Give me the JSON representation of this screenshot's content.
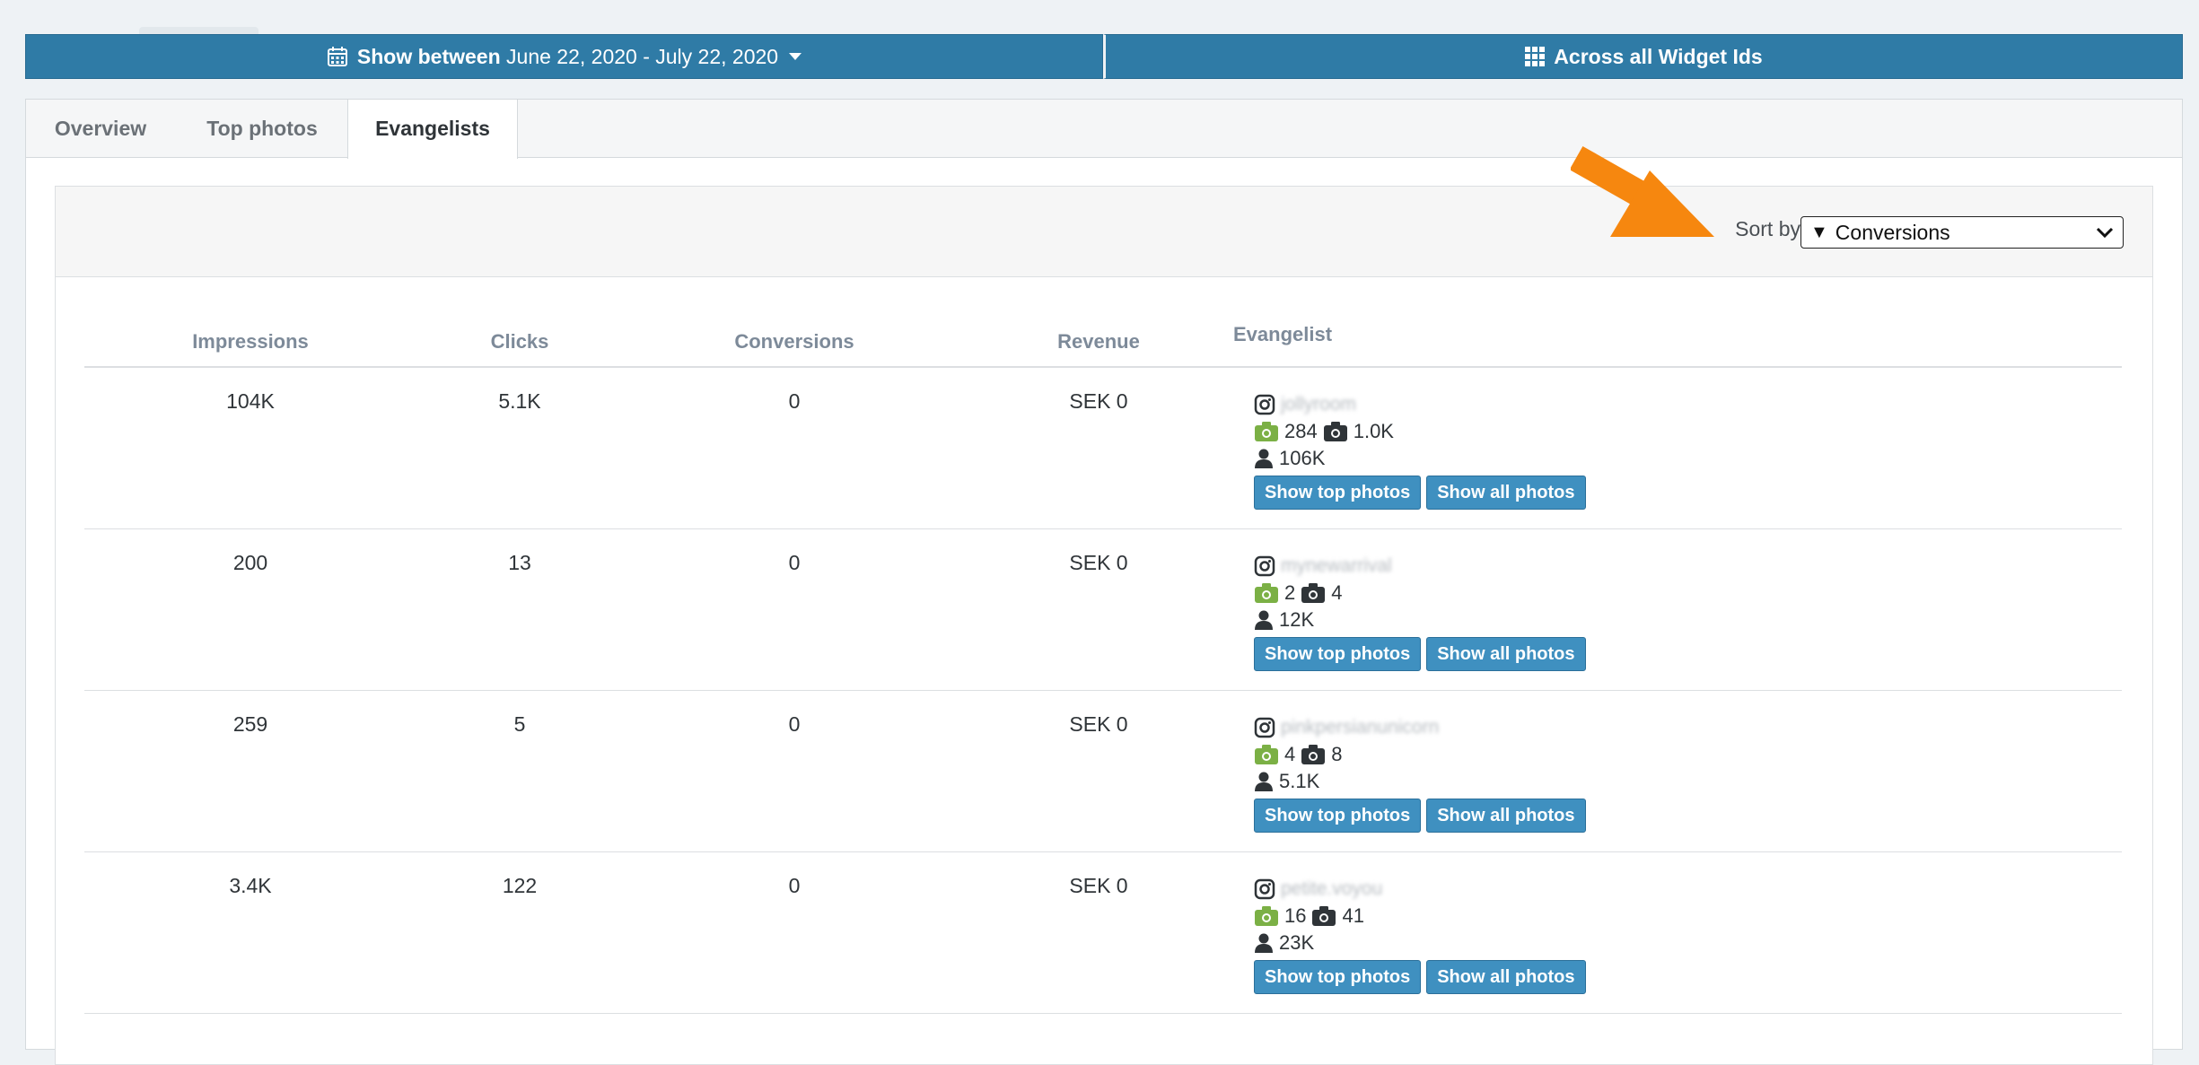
{
  "filter_bar": {
    "date_label": "Show between",
    "date_range": "June 22, 2020 - July 22, 2020",
    "widget_label": "Across all Widget Ids"
  },
  "tabs": [
    {
      "label": "Overview",
      "active": false
    },
    {
      "label": "Top photos",
      "active": false
    },
    {
      "label": "Evangelists",
      "active": true
    }
  ],
  "sort": {
    "label": "Sort by",
    "selected_marker": "▼",
    "selected": "Conversions"
  },
  "columns": {
    "impressions": "Impressions",
    "clicks": "Clicks",
    "conversions": "Conversions",
    "revenue": "Revenue",
    "evangelist": "Evangelist"
  },
  "buttons": {
    "show_top": "Show top photos",
    "show_all": "Show all photos"
  },
  "rows": [
    {
      "impressions": "104K",
      "clicks": "5.1K",
      "conversions": "0",
      "revenue": "SEK 0",
      "username": "jollyroom",
      "top_photos": "284",
      "all_photos": "1.0K",
      "followers": "106K"
    },
    {
      "impressions": "200",
      "clicks": "13",
      "conversions": "0",
      "revenue": "SEK 0",
      "username": "mynewarrival",
      "top_photos": "2",
      "all_photos": "4",
      "followers": "12K"
    },
    {
      "impressions": "259",
      "clicks": "5",
      "conversions": "0",
      "revenue": "SEK 0",
      "username": "pinkpersianunicorn",
      "top_photos": "4",
      "all_photos": "8",
      "followers": "5.1K"
    },
    {
      "impressions": "3.4K",
      "clicks": "122",
      "conversions": "0",
      "revenue": "SEK 0",
      "username": "petite.voyou",
      "top_photos": "16",
      "all_photos": "41",
      "followers": "23K"
    }
  ],
  "colors": {
    "primary_bar": "#2f7ba6",
    "button": "#3f90c0",
    "green_camera": "#7bb045",
    "arrow": "#f6870f",
    "header_text": "#7d8a99"
  },
  "icons": {
    "calendar": "calendar-icon",
    "grid": "grid-icon",
    "instagram": "instagram-icon",
    "camera": "camera-icon",
    "user": "user-icon",
    "annotation": "arrow-annotation"
  }
}
